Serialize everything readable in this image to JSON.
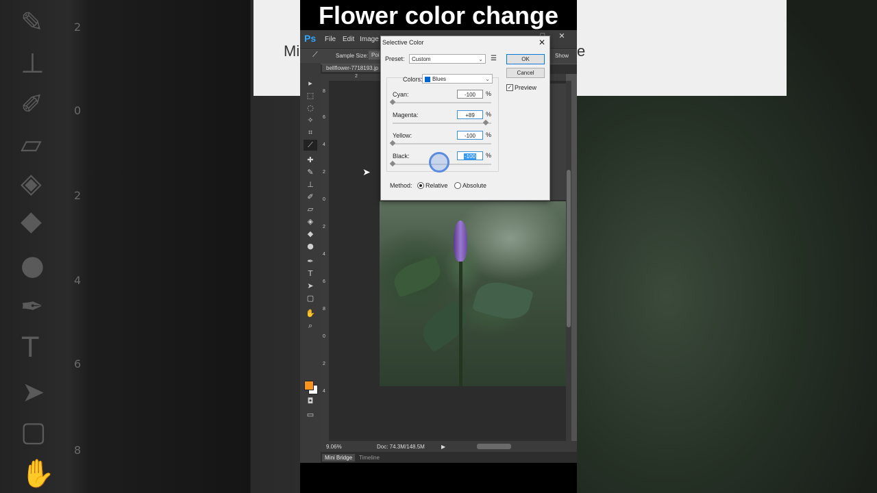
{
  "video_title": "Flower color change",
  "background": {
    "left_numbers": [
      "2",
      "0",
      "2",
      "4",
      "6",
      "8"
    ],
    "left_ruler_numbers": [
      "2",
      "0",
      "2",
      "4",
      "6",
      "8"
    ],
    "ghost_text_left": "Mi",
    "ghost_text_right": "e",
    "ghost_tools": [
      "brush-icon",
      "stamp-icon",
      "eraser-icon",
      "bucket-icon",
      "smudge-icon",
      "pen-icon",
      "type-icon",
      "arrow-icon",
      "shape-icon",
      "hand-icon"
    ]
  },
  "app": {
    "logo": "Ps",
    "menu": [
      "File",
      "Edit",
      "Image"
    ],
    "window_controls": [
      "–",
      "□",
      "✕"
    ],
    "options_bar": {
      "sample_size_label": "Sample Size:",
      "sample_size_value": "Poi",
      "show_label": "Show"
    },
    "document_tab": "bellflower-7718193.jp",
    "ruler_h_labels": [
      "2"
    ],
    "ruler_v_labels": [
      "8",
      "6",
      "4",
      "2",
      "0",
      "2",
      "4",
      "6",
      "8",
      "0",
      "2",
      "4"
    ],
    "status_bar": {
      "zoom": "9.06%",
      "doc_info": "Doc: 74.3M/148.5M"
    },
    "bottom_tabs": [
      "Mini Bridge",
      "Timeline"
    ],
    "colors": {
      "foreground": "#f7931e",
      "background": "#ffffff"
    }
  },
  "dialog": {
    "title": "Selective Color",
    "close": "✕",
    "preset_label": "Preset:",
    "preset_value": "Custom",
    "ok_label": "OK",
    "cancel_label": "Cancel",
    "preview_label": "Preview",
    "preview_checked": true,
    "colors_label": "Colors:",
    "colors_value": "Blues",
    "colors_swatch": "#0066cc",
    "sliders": [
      {
        "label": "Cyan:",
        "value": "-100",
        "percent": 0
      },
      {
        "label": "Magenta:",
        "value": "+89",
        "percent": 94.5
      },
      {
        "label": "Yellow:",
        "value": "-100",
        "percent": 0
      },
      {
        "label": "Black:",
        "value": "-100",
        "percent": 0
      }
    ],
    "percent_sign": "%",
    "method_label": "Method:",
    "method_options": [
      "Relative",
      "Absolute"
    ],
    "method_selected": "Relative"
  }
}
